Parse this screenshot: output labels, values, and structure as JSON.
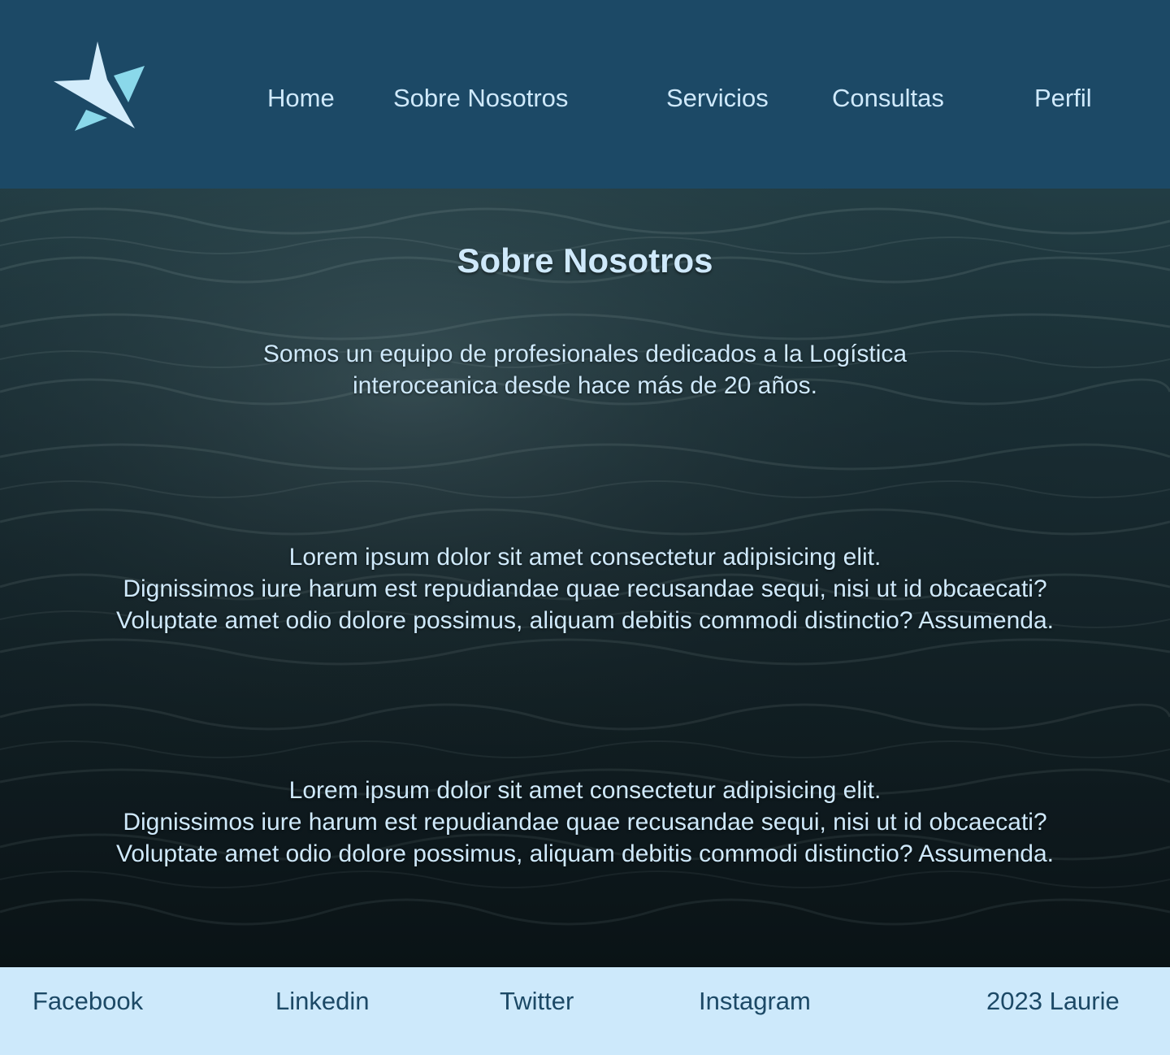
{
  "header": {
    "logo_icon": "star-logo-icon",
    "nav": {
      "home": "Home",
      "about": "Sobre Nosotros",
      "services": "Servicios",
      "inquiries": "Consultas",
      "profile": "Perfil"
    }
  },
  "main": {
    "title": "Sobre Nosotros",
    "intro": {
      "line1": "Somos un equipo de profesionales dedicados a la Logística",
      "line2": "interoceanica desde hace más de 20 años."
    },
    "paragraph1": {
      "line1": "Lorem ipsum dolor sit amet consectetur adipisicing elit.",
      "line2": "Dignissimos iure harum est repudiandae quae recusandae sequi, nisi ut id obcaecati?",
      "line3": "Voluptate amet odio dolore possimus, aliquam debitis commodi distinctio? Assumenda."
    },
    "paragraph2": {
      "line1": "Lorem ipsum dolor sit amet consectetur adipisicing elit.",
      "line2": "Dignissimos iure harum est repudiandae quae recusandae sequi, nisi ut id obcaecati?",
      "line3": "Voluptate amet odio dolore possimus, aliquam debitis commodi distinctio? Assumenda."
    }
  },
  "footer": {
    "facebook": "Facebook",
    "linkedin": "Linkedin",
    "twitter": "Twitter",
    "instagram": "Instagram",
    "copyright": "2023 Laurie"
  },
  "colors": {
    "header_bg": "#1c4966",
    "nav_text": "#cfe9fb",
    "footer_bg": "#cde9fb",
    "footer_text": "#1c4966",
    "logo_light": "#d3ecfb",
    "logo_accent": "#8ad8ea"
  }
}
